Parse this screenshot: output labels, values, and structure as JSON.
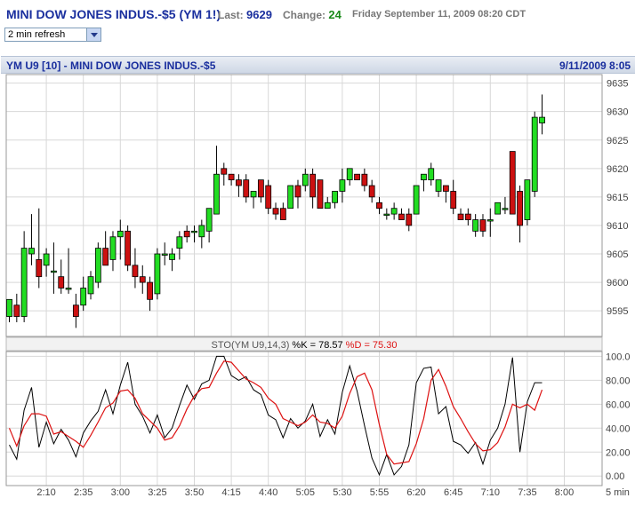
{
  "header": {
    "symbol": "MINI DOW JONES INDUS.-$5 (YM 1!)",
    "last_label": "Last:",
    "last_value": "9629",
    "change_label": "Change:",
    "change_value": "24",
    "datetime": "Friday September 11, 2009 08:20 CDT"
  },
  "refresh": {
    "selected": "2 min refresh"
  },
  "chart_bar": {
    "title": "YM U9 [10] - MINI DOW JONES INDUS.-$5",
    "date": "9/11/2009 8:05"
  },
  "colors": {
    "up": "#22dd22",
    "down": "#cc1111",
    "k_line": "#000000",
    "d_line": "#dd1111",
    "grid": "#d8d8d8"
  },
  "chart_data": [
    {
      "type": "candlestick",
      "y_ticks": [
        9595,
        9600,
        9605,
        9610,
        9615,
        9620,
        9625,
        9630,
        9635
      ],
      "ylim": [
        9590.5,
        9636.5
      ],
      "candles": [
        {
          "o": 9594,
          "h": 9597,
          "l": 9593,
          "c": 9597
        },
        {
          "o": 9596,
          "h": 9598,
          "l": 9593,
          "c": 9594
        },
        {
          "o": 9594,
          "h": 9609,
          "l": 9593,
          "c": 9606
        },
        {
          "o": 9605,
          "h": 9612,
          "l": 9603,
          "c": 9606
        },
        {
          "o": 9604,
          "h": 9613,
          "l": 9599,
          "c": 9601
        },
        {
          "o": 9603,
          "h": 9606,
          "l": 9601,
          "c": 9605
        },
        {
          "o": 9602,
          "h": 9607,
          "l": 9598,
          "c": 9602
        },
        {
          "o": 9601,
          "h": 9604,
          "l": 9598,
          "c": 9599
        },
        {
          "o": 9599,
          "h": 9606,
          "l": 9598,
          "c": 9599
        },
        {
          "o": 9596,
          "h": 9598,
          "l": 9592,
          "c": 9594
        },
        {
          "o": 9596,
          "h": 9601,
          "l": 9595,
          "c": 9599
        },
        {
          "o": 9598,
          "h": 9602,
          "l": 9597,
          "c": 9601
        },
        {
          "o": 9600,
          "h": 9607,
          "l": 9599,
          "c": 9606
        },
        {
          "o": 9606,
          "h": 9609,
          "l": 9604,
          "c": 9603
        },
        {
          "o": 9604,
          "h": 9609,
          "l": 9602,
          "c": 9608
        },
        {
          "o": 9608,
          "h": 9611,
          "l": 9604,
          "c": 9609
        },
        {
          "o": 9609,
          "h": 9610,
          "l": 9602,
          "c": 9603
        },
        {
          "o": 9603,
          "h": 9606,
          "l": 9599,
          "c": 9601
        },
        {
          "o": 9601,
          "h": 9603,
          "l": 9598,
          "c": 9600
        },
        {
          "o": 9600,
          "h": 9601,
          "l": 9595,
          "c": 9597
        },
        {
          "o": 9598,
          "h": 9606,
          "l": 9597,
          "c": 9605
        },
        {
          "o": 9605,
          "h": 9607,
          "l": 9603,
          "c": 9605
        },
        {
          "o": 9604,
          "h": 9606,
          "l": 9602,
          "c": 9605
        },
        {
          "o": 9606,
          "h": 9609,
          "l": 9604,
          "c": 9608
        },
        {
          "o": 9609,
          "h": 9610,
          "l": 9607,
          "c": 9608
        },
        {
          "o": 9609,
          "h": 9610,
          "l": 9607,
          "c": 9609
        },
        {
          "o": 9608,
          "h": 9611,
          "l": 9606,
          "c": 9610
        },
        {
          "o": 9609,
          "h": 9613,
          "l": 9607,
          "c": 9613
        },
        {
          "o": 9612,
          "h": 9624,
          "l": 9612,
          "c": 9619
        },
        {
          "o": 9620,
          "h": 9621,
          "l": 9617,
          "c": 9619
        },
        {
          "o": 9619,
          "h": 9619,
          "l": 9617,
          "c": 9618
        },
        {
          "o": 9618,
          "h": 9619,
          "l": 9615,
          "c": 9617
        },
        {
          "o": 9618,
          "h": 9619,
          "l": 9614,
          "c": 9615
        },
        {
          "o": 9615,
          "h": 9616,
          "l": 9613,
          "c": 9616
        },
        {
          "o": 9618,
          "h": 9618,
          "l": 9614,
          "c": 9615
        },
        {
          "o": 9617,
          "h": 9618,
          "l": 9612,
          "c": 9613
        },
        {
          "o": 9613,
          "h": 9614,
          "l": 9611,
          "c": 9612
        },
        {
          "o": 9613,
          "h": 9614,
          "l": 9611,
          "c": 9611
        },
        {
          "o": 9613,
          "h": 9617,
          "l": 9613,
          "c": 9617
        },
        {
          "o": 9617,
          "h": 9618,
          "l": 9613,
          "c": 9615
        },
        {
          "o": 9617,
          "h": 9620,
          "l": 9616,
          "c": 9619
        },
        {
          "o": 9619,
          "h": 9620,
          "l": 9613,
          "c": 9615
        },
        {
          "o": 9618,
          "h": 9618,
          "l": 9613,
          "c": 9613
        },
        {
          "o": 9613,
          "h": 9615,
          "l": 9613,
          "c": 9614
        },
        {
          "o": 9614,
          "h": 9616,
          "l": 9613,
          "c": 9616
        },
        {
          "o": 9616,
          "h": 9620,
          "l": 9614,
          "c": 9618
        },
        {
          "o": 9618,
          "h": 9620,
          "l": 9617,
          "c": 9620
        },
        {
          "o": 9619,
          "h": 9619,
          "l": 9618,
          "c": 9618
        },
        {
          "o": 9619,
          "h": 9620,
          "l": 9616,
          "c": 9617
        },
        {
          "o": 9617,
          "h": 9618,
          "l": 9614,
          "c": 9615
        },
        {
          "o": 9614,
          "h": 9615,
          "l": 9612,
          "c": 9613
        },
        {
          "o": 9612,
          "h": 9613,
          "l": 9611,
          "c": 9612
        },
        {
          "o": 9612,
          "h": 9614,
          "l": 9611,
          "c": 9613
        },
        {
          "o": 9612,
          "h": 9613,
          "l": 9611,
          "c": 9611
        },
        {
          "o": 9612,
          "h": 9613,
          "l": 9609,
          "c": 9610
        },
        {
          "o": 9612,
          "h": 9616,
          "l": 9612,
          "c": 9617
        },
        {
          "o": 9618,
          "h": 9619,
          "l": 9616,
          "c": 9619
        },
        {
          "o": 9618,
          "h": 9621,
          "l": 9617,
          "c": 9620
        },
        {
          "o": 9616,
          "h": 9618,
          "l": 9615,
          "c": 9618
        },
        {
          "o": 9617,
          "h": 9617,
          "l": 9614,
          "c": 9616
        },
        {
          "o": 9616,
          "h": 9618,
          "l": 9612,
          "c": 9613
        },
        {
          "o": 9612,
          "h": 9613,
          "l": 9611,
          "c": 9611
        },
        {
          "o": 9612,
          "h": 9613,
          "l": 9610,
          "c": 9611
        },
        {
          "o": 9609,
          "h": 9612,
          "l": 9608,
          "c": 9611
        },
        {
          "o": 9611,
          "h": 9612,
          "l": 9608,
          "c": 9609
        },
        {
          "o": 9611,
          "h": 9613,
          "l": 9608,
          "c": 9611
        },
        {
          "o": 9612,
          "h": 9614,
          "l": 9612,
          "c": 9614
        },
        {
          "o": 9613,
          "h": 9615,
          "l": 9612,
          "c": 9613
        },
        {
          "o": 9623,
          "h": 9623,
          "l": 9612,
          "c": 9612
        },
        {
          "o": 9616,
          "h": 9617,
          "l": 9607,
          "c": 9610
        },
        {
          "o": 9611,
          "h": 9618,
          "l": 9610,
          "c": 9618
        },
        {
          "o": 9616,
          "h": 9630,
          "l": 9615,
          "c": 9629
        },
        {
          "o": 9628,
          "h": 9633,
          "l": 9626,
          "c": 9629
        }
      ]
    },
    {
      "type": "line",
      "title": "STO(YM U9,14,3)",
      "k_label": "%K = 78.57",
      "d_label": "%D = 75.30",
      "y_ticks": [
        0,
        20,
        40,
        60,
        80,
        100
      ],
      "y_tick_labels": [
        "0.00",
        "20.00",
        "40.00",
        "60.00",
        "80.00",
        "100.0"
      ],
      "ylim": [
        -8,
        104
      ],
      "series": [
        {
          "name": "%K",
          "values": [
            26,
            14,
            55,
            74,
            24,
            45,
            27,
            39,
            30,
            16,
            36,
            46,
            54,
            72,
            52,
            76,
            95,
            60,
            50,
            36,
            51,
            32,
            40,
            59,
            76,
            64,
            77,
            80,
            100,
            100,
            84,
            80,
            83,
            72,
            68,
            51,
            47,
            32,
            48,
            40,
            46,
            60,
            33,
            47,
            35,
            70,
            92,
            71,
            42,
            15,
            1,
            18,
            1,
            8,
            26,
            78,
            90,
            91,
            52,
            58,
            29,
            26,
            19,
            28,
            10,
            30,
            40,
            60,
            99,
            20,
            62,
            78,
            78
          ]
        },
        {
          "name": "%D",
          "values": [
            40,
            25,
            42,
            52,
            52,
            50,
            35,
            37,
            33,
            29,
            24,
            34,
            45,
            57,
            61,
            71,
            72,
            65,
            52,
            46,
            40,
            30,
            32,
            42,
            56,
            67,
            73,
            74,
            86,
            96,
            95,
            88,
            81,
            78,
            74,
            65,
            60,
            48,
            45,
            42,
            45,
            51,
            45,
            44,
            40,
            50,
            69,
            83,
            86,
            72,
            43,
            18,
            10,
            11,
            12,
            27,
            48,
            80,
            89,
            75,
            58,
            48,
            37,
            27,
            21,
            22,
            28,
            41,
            60,
            57,
            60,
            55,
            72
          ]
        }
      ]
    }
  ],
  "x_axis": {
    "tick_labels": [
      "2:10",
      "2:35",
      "3:00",
      "3:25",
      "3:50",
      "4:15",
      "4:40",
      "5:05",
      "5:30",
      "5:55",
      "6:20",
      "6:45",
      "7:10",
      "7:35",
      "8:00"
    ],
    "interval_label": "5 min"
  }
}
